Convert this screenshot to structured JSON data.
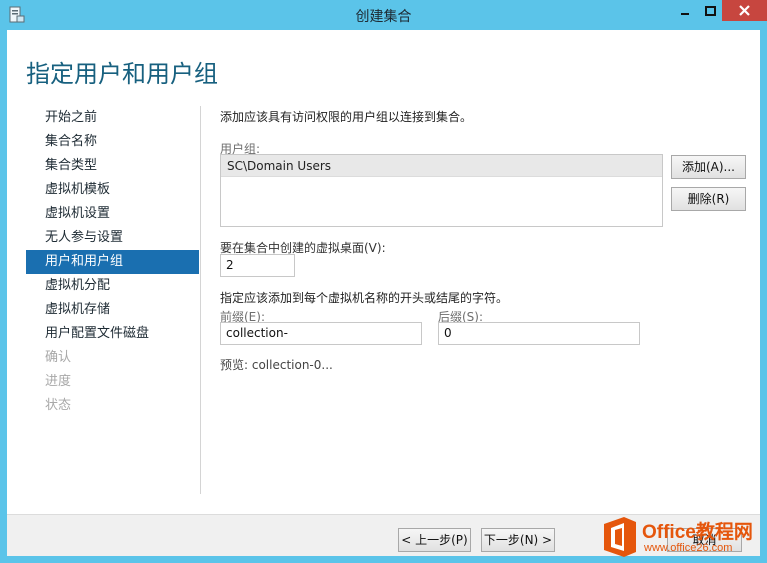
{
  "window": {
    "title": "创建集合",
    "icon": "server-manager-icon"
  },
  "page": {
    "title": "指定用户和用户组"
  },
  "nav": {
    "items": [
      {
        "label": "开始之前",
        "state": "normal"
      },
      {
        "label": "集合名称",
        "state": "normal"
      },
      {
        "label": "集合类型",
        "state": "normal"
      },
      {
        "label": "虚拟机模板",
        "state": "normal"
      },
      {
        "label": "虚拟机设置",
        "state": "normal"
      },
      {
        "label": "无人参与设置",
        "state": "normal"
      },
      {
        "label": "用户和用户组",
        "state": "active"
      },
      {
        "label": "虚拟机分配",
        "state": "normal"
      },
      {
        "label": "虚拟机存储",
        "state": "normal"
      },
      {
        "label": "用户配置文件磁盘",
        "state": "normal"
      },
      {
        "label": "确认",
        "state": "disabled"
      },
      {
        "label": "进度",
        "state": "disabled"
      },
      {
        "label": "状态",
        "state": "disabled"
      }
    ]
  },
  "content": {
    "intro": "添加应该具有访问权限的用户组以连接到集合。",
    "groups_label": "用户组:",
    "groups": [
      "SC\\Domain Users"
    ],
    "add_button": "添加(A)...",
    "remove_button": "删除(R)",
    "count_label": "要在集合中创建的虚拟桌面(V):",
    "count_value": "2",
    "name_desc": "指定应该添加到每个虚拟机名称的开头或结尾的字符。",
    "prefix_label": "前缀(E):",
    "prefix_value": "collection-",
    "suffix_label": "后缀(S):",
    "suffix_value": "0",
    "preview": "预览: collection-0..."
  },
  "footer": {
    "prev_button": "< 上一步(P)",
    "next_button": "下一步(N) >",
    "cancel_button": "取消"
  },
  "watermark": {
    "title": "Office教程网",
    "url": "www.office26.com"
  },
  "colors": {
    "titlebar": "#5bc4e9",
    "accent": "#1a6fb0",
    "heading": "#17607f",
    "close": "#c7463f",
    "watermark": "#e5560c"
  }
}
